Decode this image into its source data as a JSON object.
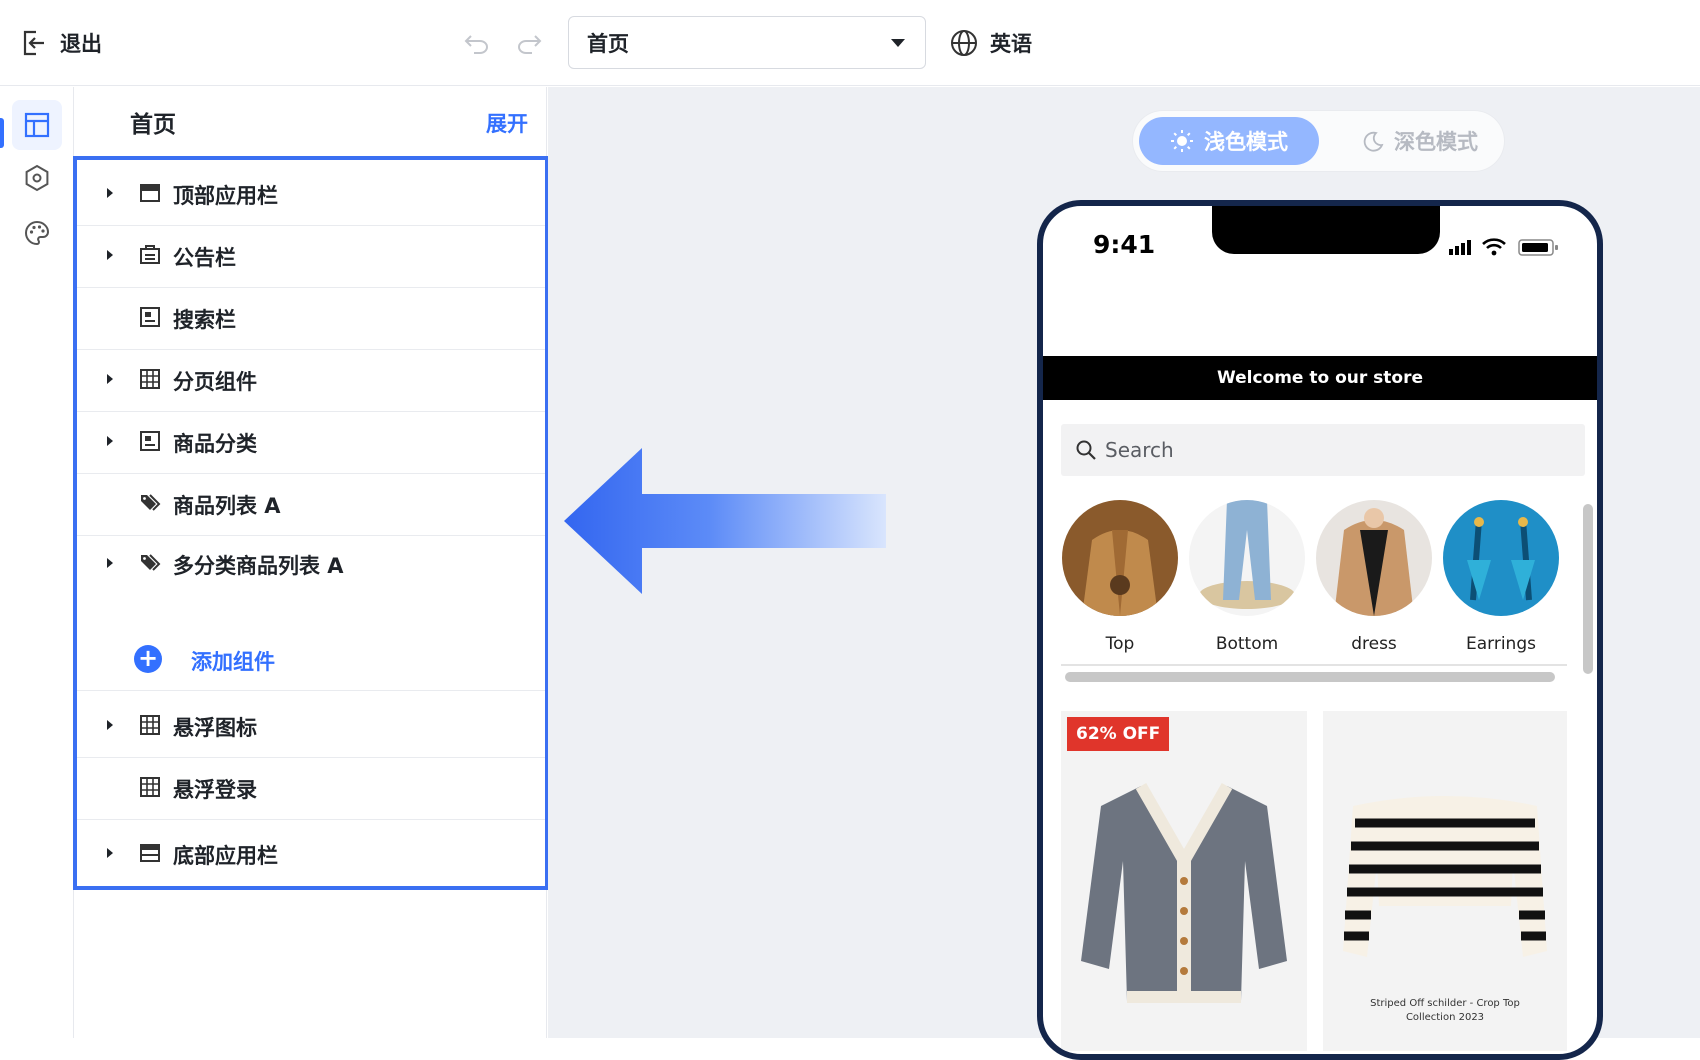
{
  "toolbar": {
    "exit_label": "退出",
    "page_select_value": "首页",
    "language_label": "英语"
  },
  "panel": {
    "title": "首页",
    "expand_label": "展开",
    "items": [
      {
        "label": "顶部应用栏",
        "icon": "app-bar-icon",
        "expandable": true
      },
      {
        "label": "公告栏",
        "icon": "notice-icon",
        "expandable": true
      },
      {
        "label": "搜索栏",
        "icon": "search-bar-icon",
        "expandable": false
      },
      {
        "label": "分页组件",
        "icon": "pagination-icon",
        "expandable": true
      },
      {
        "label": "商品分类",
        "icon": "category-icon",
        "expandable": true
      },
      {
        "label": "商品列表 A",
        "icon": "tag-icon",
        "expandable": false
      },
      {
        "label": "多分类商品列表 A",
        "icon": "tag-icon",
        "expandable": true
      },
      {
        "label": "悬浮图标",
        "icon": "grid-icon",
        "expandable": true
      },
      {
        "label": "悬浮登录",
        "icon": "grid-icon",
        "expandable": false
      },
      {
        "label": "底部应用栏",
        "icon": "bottom-bar-icon",
        "expandable": true
      }
    ],
    "add_component_label": "添加组件"
  },
  "mode_toggle": {
    "light_label": "浅色模式",
    "dark_label": "深色模式"
  },
  "phone": {
    "time": "9:41",
    "welcome_text": "Welcome to our store",
    "search_placeholder": "Search",
    "categories": [
      {
        "name": "Top"
      },
      {
        "name": "Bottom"
      },
      {
        "name": "dress"
      },
      {
        "name": "Earrings"
      }
    ],
    "products": [
      {
        "badge": "62% OFF"
      },
      {
        "caption_line1": "Striped Off schilder - Crop Top",
        "caption_line2": "Collection 2023"
      }
    ]
  },
  "colors": {
    "accent": "#3370ff",
    "highlight_border": "#3a6ff2",
    "badge_red": "#e0352b",
    "phone_frame": "#14264b"
  }
}
